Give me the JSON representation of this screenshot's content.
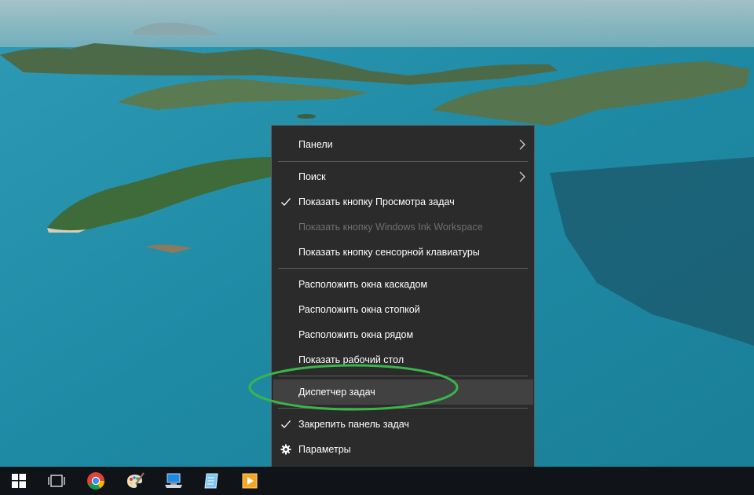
{
  "context_menu": {
    "items": [
      {
        "label": "Панели",
        "submenu": true
      },
      {
        "label": "Поиск",
        "submenu": true
      },
      {
        "label": "Показать кнопку Просмотра задач",
        "checked": true
      },
      {
        "label": "Показать кнопку Windows Ink Workspace",
        "disabled": true
      },
      {
        "label": "Показать кнопку сенсорной клавиатуры"
      },
      {
        "label": "Расположить окна каскадом"
      },
      {
        "label": "Расположить окна стопкой"
      },
      {
        "label": "Расположить окна рядом"
      },
      {
        "label": "Показать рабочий стол"
      },
      {
        "label": "Диспетчер задач",
        "highlighted": true
      },
      {
        "label": "Закрепить панель задач",
        "checked": true
      },
      {
        "label": "Параметры",
        "icon": "gear-icon"
      }
    ]
  },
  "taskbar": {
    "icons": [
      "windows-start-icon",
      "task-view-icon",
      "chrome-icon",
      "paint-icon",
      "remote-desktop-icon",
      "notepad-icon",
      "media-player-icon"
    ]
  },
  "colors": {
    "menu_bg": "#2b2b2b",
    "menu_highlight": "#414141",
    "annotation_ellipse": "#3ab54a",
    "taskbar_bg": "#101418"
  }
}
